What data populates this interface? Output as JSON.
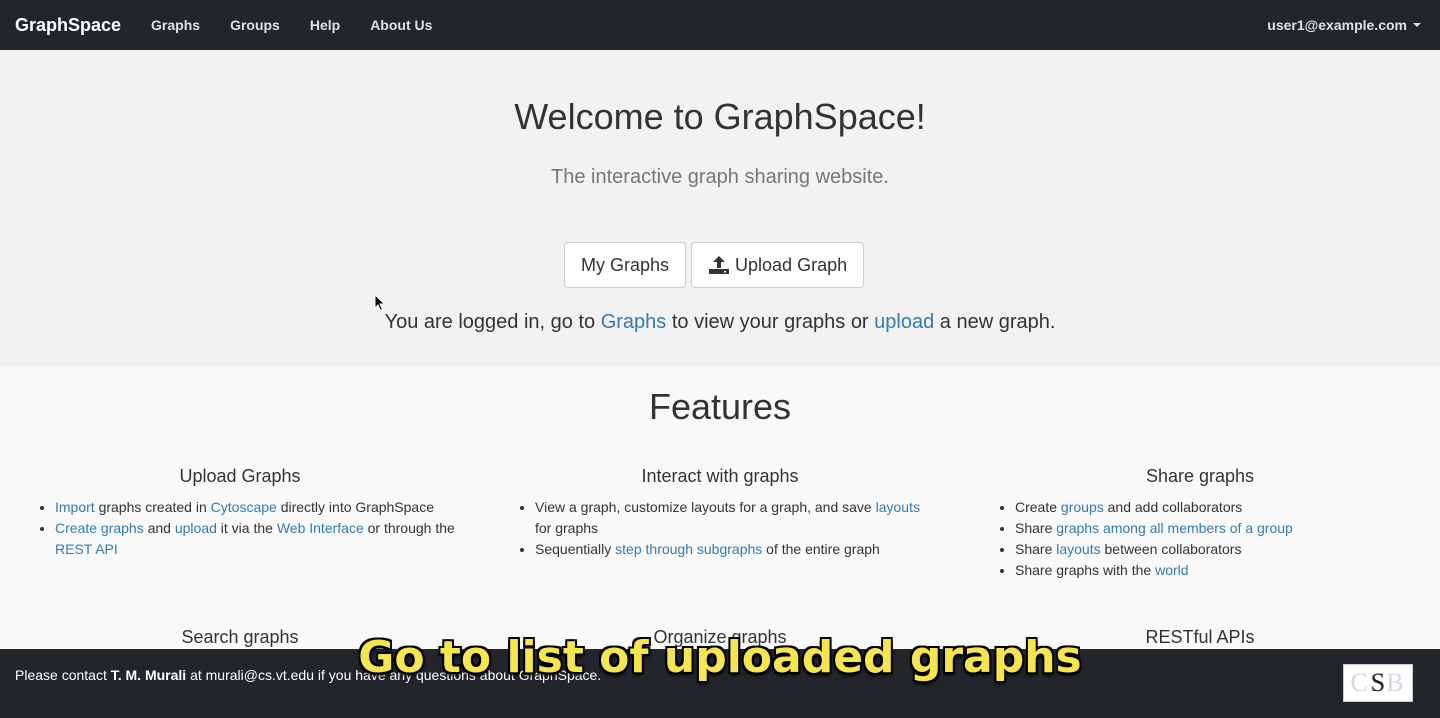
{
  "navbar": {
    "brand": "GraphSpace",
    "items": [
      "Graphs",
      "Groups",
      "Help",
      "About Us"
    ],
    "user": "user1@example.com"
  },
  "jumbotron": {
    "title": "Welcome to GraphSpace!",
    "subtitle": "The interactive graph sharing website.",
    "buttons": {
      "my_graphs": "My Graphs",
      "upload_graph": "Upload Graph"
    },
    "logged_in": {
      "prefix": "You are logged in, go to ",
      "graphs_link": "Graphs",
      "middle": " to view your graphs or ",
      "upload_link": "upload",
      "suffix": " a new graph."
    }
  },
  "features": {
    "title": "Features",
    "upload": {
      "title": "Upload Graphs",
      "item1": {
        "link1": "Import",
        "t1": " graphs created in ",
        "link2": "Cytoscape",
        "t2": " directly into GraphSpace"
      },
      "item2": {
        "link1": "Create graphs",
        "t1": " and ",
        "link2": "upload",
        "t2": " it via the ",
        "link3": "Web Interface",
        "t3": " or through the ",
        "link4": "REST API"
      }
    },
    "interact": {
      "title": "Interact with graphs",
      "item1": {
        "t1": "View a graph, customize layouts for a graph, and save ",
        "link1": "layouts",
        "t2": " for graphs"
      },
      "item2": {
        "t1": "Sequentially ",
        "link1": "step through subgraphs",
        "t2": " of the entire graph"
      }
    },
    "share": {
      "title": "Share graphs",
      "item1": {
        "t1": "Create ",
        "link1": "groups",
        "t2": " and add collaborators"
      },
      "item2": {
        "t1": "Share ",
        "link1": "graphs among all members of a group"
      },
      "item3": {
        "t1": "Share ",
        "link1": "layouts",
        "t2": " between collaborators"
      },
      "item4": {
        "t1": "Share graphs with the ",
        "link1": "world"
      }
    },
    "row2": [
      "Search graphs",
      "Organize graphs",
      "RESTful APIs"
    ]
  },
  "footer": {
    "prefix": "Please contact ",
    "name": "T. M. Murali",
    "middle": " at murali@cs.vt.edu if you ",
    "rest": "have any questions about GraphSpace.",
    "logo_text": "S",
    "logo_bg": "CSB"
  },
  "caption": "Go to list of uploaded graphs"
}
